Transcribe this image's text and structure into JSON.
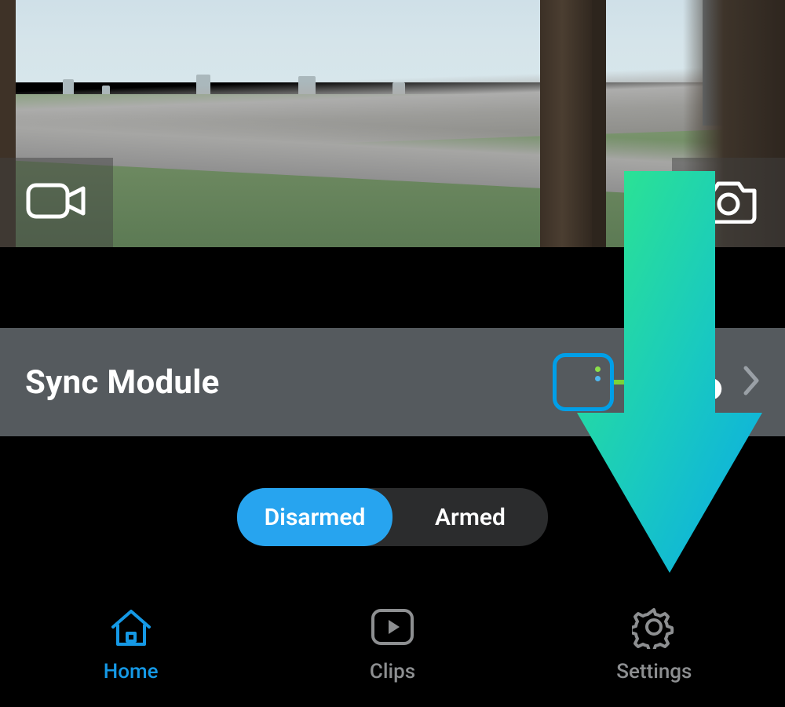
{
  "camera": {
    "name": "camera-thumbnail"
  },
  "sync": {
    "title": "Sync Module"
  },
  "toggle": {
    "disarmed": "Disarmed",
    "armed": "Armed"
  },
  "nav": {
    "home": "Home",
    "clips": "Clips",
    "settings": "Settings"
  }
}
